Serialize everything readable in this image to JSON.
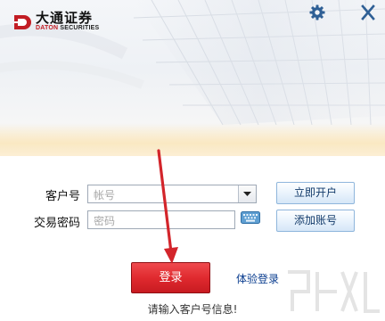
{
  "header": {
    "logo_cn": "大通证券",
    "logo_en_prefix": "DATON",
    "logo_en_suffix": "SECURITIES"
  },
  "form": {
    "account_label": "客户号",
    "account_placeholder": "帐号",
    "password_label": "交易密码",
    "password_placeholder": "密码"
  },
  "buttons": {
    "open_account": "立即开户",
    "add_account": "添加账号",
    "login": "登录",
    "trial_login": "体验登录"
  },
  "status_text": "请输入客户号信息!",
  "colors": {
    "login_red": "#e02a2f",
    "annotation_arrow": "#d3252b",
    "link_blue": "#0a3d8f",
    "button_border_blue": "#8fb6dc"
  },
  "icons": {
    "settings": "gear-icon",
    "close": "close-icon",
    "dropdown": "chevron-down-icon",
    "keyboard": "keyboard-icon"
  }
}
